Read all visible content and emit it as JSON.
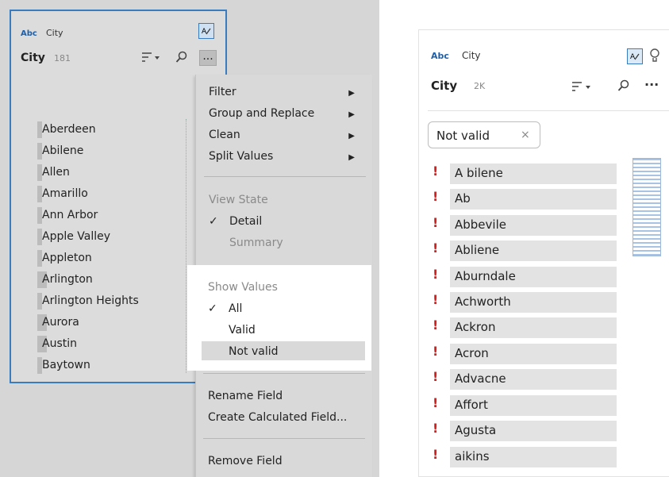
{
  "left": {
    "type_badge": "Abc",
    "type_name": "City",
    "field_name": "City",
    "count": "181",
    "more_label": "...",
    "values": [
      "Aberdeen",
      "Abilene",
      "Allen",
      "Amarillo",
      "Ann Arbor",
      "Apple Valley",
      "Appleton",
      "Arlington",
      "Arlington Heights",
      "Aurora",
      "Austin",
      "Baytown"
    ]
  },
  "menu": {
    "filter": "Filter",
    "group_replace": "Group and Replace",
    "clean": "Clean",
    "split_values": "Split Values",
    "view_state_header": "View State",
    "detail": "Detail",
    "summary": "Summary",
    "show_values_header": "Show Values",
    "all": "All",
    "valid": "Valid",
    "not_valid": "Not valid",
    "rename_field": "Rename Field",
    "create_calc": "Create Calculated Field...",
    "remove_field": "Remove Field",
    "check": "✓",
    "submenu_arrow": "▶"
  },
  "right": {
    "type_badge": "Abc",
    "type_name": "City",
    "field_name": "City",
    "count": "2K",
    "more_label": "···",
    "filter_chip": "Not valid",
    "chip_close": "×",
    "error_mark": "!",
    "values": [
      "A bilene",
      "Ab",
      "Abbevile",
      "Abliene",
      "Aburndale",
      "Achworth",
      "Ackron",
      "Acron",
      "Advacne",
      "Affort",
      "Agusta",
      "aikins"
    ]
  },
  "icons": {
    "data_role": "data-role-icon",
    "sort": "sort-icon",
    "search": "search-icon",
    "recommend": "lightbulb-icon"
  },
  "colors": {
    "accent": "#3a7cc0",
    "error": "#d02020"
  }
}
